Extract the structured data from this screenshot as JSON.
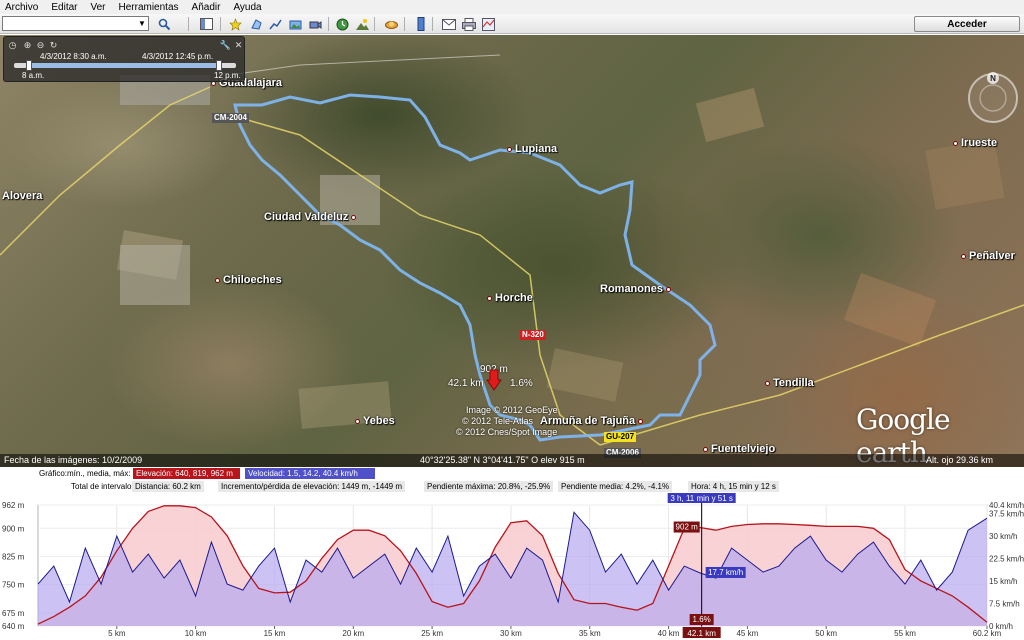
{
  "menu": [
    "Archivo",
    "Editar",
    "Ver",
    "Herramientas",
    "Añadir",
    "Ayuda"
  ],
  "toolbar": {
    "login_label": "Acceder",
    "icons": [
      "search-icon",
      "sidebar-toggle-icon",
      "placemark-icon",
      "polygon-icon",
      "path-icon",
      "image-overlay-icon",
      "tour-icon",
      "historical-imagery-icon",
      "sunlight-icon",
      "planets-icon",
      "ruler-icon",
      "email-icon",
      "print-icon",
      "google-maps-icon"
    ]
  },
  "time_slider": {
    "start_label": "4/3/2012  8:30 a.m.",
    "end_label": "4/3/2012  12:45 p.m.",
    "left_tick": "8 a.m.",
    "right_tick": "12 p.m."
  },
  "map": {
    "places": [
      {
        "name": "Guadalajara"
      },
      {
        "name": "Lupiana"
      },
      {
        "name": "Irueste"
      },
      {
        "name": "Alovera"
      },
      {
        "name": "Ciudad Valdeluz"
      },
      {
        "name": "Peñalver"
      },
      {
        "name": "Chiloeches"
      },
      {
        "name": "Horche"
      },
      {
        "name": "Romanones"
      },
      {
        "name": "Tendilla"
      },
      {
        "name": "Yebes"
      },
      {
        "name": "Armuña de Tajuña"
      },
      {
        "name": "Fuentelviejo"
      }
    ],
    "roads": [
      "CM-2004",
      "N-320",
      "GU-207",
      "CM-2006"
    ],
    "cursor_elevation": "902 m",
    "cursor_distance": "42.1 km",
    "cursor_slope": "1.6%",
    "credits": [
      "Image © 2012 GeoEye",
      "© 2012 Tele-Atlas",
      "© 2012 Cnes/Spot Image"
    ],
    "logo": "Google earth",
    "compass_letter": "N"
  },
  "infobar": {
    "imagery_date": "Fecha de las imágenes: 10/2/2009",
    "coordinates": "40°32'25.38\" N   3°04'41.75\" O  elev  915 m",
    "eye_alt": "Alt. ojo  29.36 km"
  },
  "profile": {
    "graph_label": "Gráfico:",
    "graph_stats": "mín., media, máx:",
    "elevation_stat": "Elevación: 640, 819, 962 m",
    "speed_stat": "Velocidad: 1.5, 14.2, 40.4 km/h",
    "interval_label": "Total de intervalo:",
    "distance": "Distancia: 60.2 km",
    "gain_loss": "Incremento/pérdida de elevación: 1449 m, -1449 m",
    "max_slope": "Pendiente máxima: 20.8%, -25.9%",
    "avg_slope": "Pendiente media: 4.2%, -4.1%",
    "time": "Hora: 4 h, 15 min y 12 s",
    "cursor_time": "3 h, 11 min y 51 s",
    "cursor_elevation": "902 m",
    "cursor_speed": "17.7 km/h",
    "cursor_slope": "1.6%",
    "cursor_distance": "42.1 km",
    "colors": {
      "elevation": "#b8141c",
      "elevation_fill": "#f8cdd0",
      "speed": "#1a1a8c",
      "speed_fill": "#b7a8f0"
    }
  },
  "chart_data": {
    "type": "area",
    "x_unit": "km",
    "x_ticks": [
      "5 km",
      "10 km",
      "15 km",
      "20 km",
      "25 km",
      "30 km",
      "35 km",
      "40 km",
      "42.1 km",
      "45 km",
      "50 km",
      "55 km",
      "60.2 km"
    ],
    "xlim": [
      0,
      60.2
    ],
    "left_axis_ticks": [
      "962 m",
      "900 m",
      "825 m",
      "750 m",
      "675 m",
      "640 m"
    ],
    "right_axis_ticks": [
      "40.4 km/h",
      "37.5 km/h",
      "30 km/h",
      "22.5 km/h",
      "15 km/h",
      "7.5 km/h",
      "0 km/h"
    ],
    "elevation_ylim": [
      640,
      962
    ],
    "speed_ylim": [
      0,
      40.4
    ],
    "series": [
      {
        "name": "Elevación",
        "axis": "left",
        "x": [
          0,
          1,
          2,
          3,
          4,
          5,
          6,
          7,
          8,
          9,
          10,
          11,
          12,
          13,
          14,
          15,
          16,
          17,
          18,
          19,
          20,
          21,
          22,
          23,
          24,
          25,
          26,
          27,
          28,
          29,
          30,
          31,
          32,
          33,
          34,
          35,
          36,
          37,
          38,
          39,
          40,
          41,
          42,
          43,
          44,
          45,
          46,
          47,
          48,
          49,
          50,
          51,
          52,
          53,
          54,
          55,
          56,
          57,
          58,
          59,
          60.2
        ],
        "values": [
          645,
          665,
          690,
          720,
          770,
          840,
          900,
          945,
          960,
          960,
          955,
          930,
          880,
          800,
          740,
          728,
          730,
          760,
          820,
          870,
          895,
          895,
          880,
          840,
          780,
          705,
          690,
          700,
          760,
          850,
          915,
          920,
          880,
          780,
          710,
          700,
          700,
          690,
          682,
          700,
          800,
          900,
          902,
          895,
          905,
          910,
          912,
          912,
          910,
          908,
          905,
          905,
          905,
          900,
          870,
          790,
          760,
          740,
          720,
          690,
          650
        ]
      },
      {
        "name": "Velocidad",
        "axis": "right",
        "x": [
          0,
          1,
          2,
          3,
          4,
          5,
          6,
          7,
          8,
          9,
          10,
          11,
          12,
          13,
          14,
          15,
          16,
          17,
          18,
          19,
          20,
          21,
          22,
          23,
          24,
          25,
          26,
          27,
          28,
          29,
          30,
          31,
          32,
          33,
          34,
          35,
          36,
          37,
          38,
          39,
          40,
          41,
          42,
          43,
          44,
          45,
          46,
          47,
          48,
          49,
          50,
          51,
          52,
          53,
          54,
          55,
          56,
          57,
          58,
          59,
          60.2
        ],
        "values": [
          14,
          20,
          8,
          26,
          14,
          30,
          18,
          24,
          16,
          22,
          10,
          28,
          14,
          12,
          20,
          26,
          8,
          22,
          18,
          26,
          16,
          20,
          24,
          14,
          26,
          18,
          30,
          10,
          20,
          24,
          16,
          26,
          22,
          8,
          38,
          32,
          18,
          24,
          14,
          22,
          12,
          20,
          17.7,
          16,
          26,
          22,
          18,
          20,
          26,
          30,
          22,
          18,
          24,
          28,
          20,
          14,
          22,
          12,
          18,
          32,
          36
        ]
      }
    ]
  }
}
